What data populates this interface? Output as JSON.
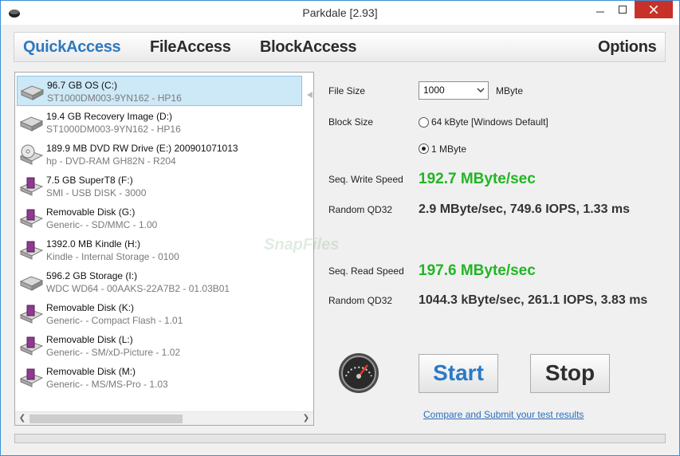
{
  "window": {
    "title": "Parkdale [2.93]"
  },
  "tabs": [
    {
      "label": "QuickAccess",
      "active": true
    },
    {
      "label": "FileAccess",
      "active": false
    },
    {
      "label": "BlockAccess",
      "active": false
    },
    {
      "label": "Options",
      "active": false
    }
  ],
  "drives": [
    {
      "name": "96.7 GB OS (C:)",
      "detail": "ST1000DM003-9YN162 - HP16",
      "type": "hdd",
      "selected": true
    },
    {
      "name": "19.4 GB Recovery Image (D:)",
      "detail": "ST1000DM003-9YN162 - HP16",
      "type": "hdd",
      "selected": false
    },
    {
      "name": "189.9 MB DVD RW Drive (E:) 200901071013",
      "detail": "hp - DVD-RAM GH82N - R204",
      "type": "dvd",
      "selected": false
    },
    {
      "name": "7.5 GB SuperT8 (F:)",
      "detail": "SMI - USB DISK - 3000",
      "type": "removable",
      "selected": false
    },
    {
      "name": "Removable Disk (G:)",
      "detail": "Generic- - SD/MMC - 1.00",
      "type": "removable",
      "selected": false
    },
    {
      "name": "1392.0 MB Kindle (H:)",
      "detail": "Kindle - Internal Storage - 0100",
      "type": "removable",
      "selected": false
    },
    {
      "name": "596.2 GB Storage (I:)",
      "detail": "WDC WD64 - 00AAKS-22A7B2 - 01.03B01",
      "type": "hdd",
      "selected": false
    },
    {
      "name": "Removable Disk (K:)",
      "detail": "Generic- - Compact Flash - 1.01",
      "type": "removable",
      "selected": false
    },
    {
      "name": "Removable Disk (L:)",
      "detail": "Generic- - SM/xD-Picture - 1.02",
      "type": "removable",
      "selected": false
    },
    {
      "name": "Removable Disk (M:)",
      "detail": "Generic- - MS/MS-Pro - 1.03",
      "type": "removable",
      "selected": false
    }
  ],
  "settings": {
    "file_size_label": "File Size",
    "file_size_value": "1000",
    "file_size_unit": "MByte",
    "block_size_label": "Block Size",
    "block_options": [
      {
        "label": "64 kByte [Windows Default]",
        "checked": false
      },
      {
        "label": "1 MByte",
        "checked": true
      }
    ]
  },
  "results": {
    "seq_write_label": "Seq. Write Speed",
    "seq_write_value": "192.7 MByte/sec",
    "random_write_label": "Random QD32",
    "random_write_value": "2.9 MByte/sec, 749.6 IOPS, 1.33 ms",
    "seq_read_label": "Seq. Read Speed",
    "seq_read_value": "197.6 MByte/sec",
    "random_read_label": "Random QD32",
    "random_read_value": "1044.3 kByte/sec, 261.1 IOPS, 3.83 ms"
  },
  "actions": {
    "start_label": "Start",
    "stop_label": "Stop",
    "compare_link": "Compare and Submit your test results"
  },
  "watermark": "SnapFiles",
  "colors": {
    "accent": "#2e78c2",
    "speed": "#21b524",
    "close": "#c7312a"
  }
}
